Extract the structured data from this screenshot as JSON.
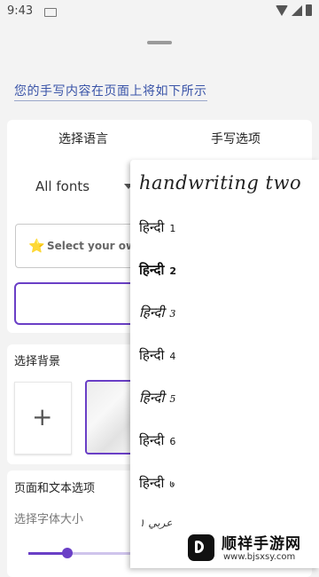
{
  "status": {
    "time": "9:43"
  },
  "preview": {
    "text": "您的手写内容在页面上将如下所示"
  },
  "tabs": {
    "language": "选择语言",
    "handwriting": "手写选项"
  },
  "font_select": {
    "value": "All fonts"
  },
  "select_own": {
    "icon": "star-icon",
    "star": "⭐",
    "label": "Select your own"
  },
  "background": {
    "title": "选择背景",
    "add_symbol": "+"
  },
  "page_options": {
    "title": "页面和文本选项",
    "font_size_label": "选择字体大小",
    "font_size_level_percent": 34
  },
  "dropdown": {
    "first": "handwriting two",
    "items": [
      {
        "script": "हिन्दी",
        "num": "1"
      },
      {
        "script": "हिन्दी",
        "num": "2"
      },
      {
        "script": "हिन्दी",
        "num": "3"
      },
      {
        "script": "हिन्दी",
        "num": "4"
      },
      {
        "script": "हिन्दी",
        "num": "5"
      },
      {
        "script": "हिन्दी",
        "num": "6"
      },
      {
        "script": "हिन्दी",
        "num": "७"
      }
    ],
    "arabic": "عربي ١"
  },
  "watermark": {
    "name": "顺祥手游网",
    "url": "www.bjsxsy.com"
  },
  "colors": {
    "accent": "#6a3fc6",
    "link_text": "#3a54a8"
  }
}
